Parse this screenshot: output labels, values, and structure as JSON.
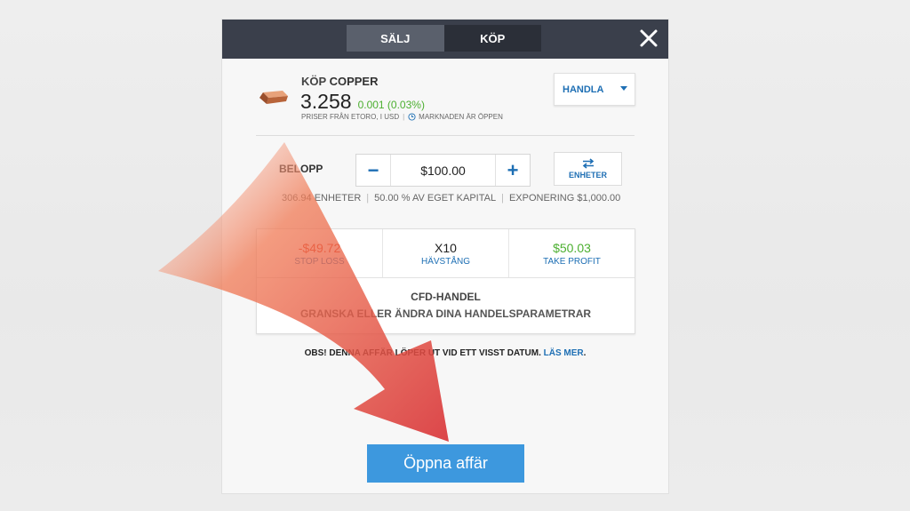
{
  "tabs": [
    {
      "label": "SÄLJ",
      "active": true
    },
    {
      "label": "KÖP",
      "active": false
    }
  ],
  "instrument": {
    "action": "KÖP",
    "name": "COPPER",
    "price": "3.258",
    "change": "0.001 (0.03%)",
    "price_source": "PRISER FRÅN ETORO, I USD",
    "market_status": "MARKNADEN ÄR ÖPPEN",
    "icon": "copper-ingot-icon"
  },
  "trade_dropdown": {
    "label": "HANDLA"
  },
  "amount": {
    "label": "BELOPP",
    "value": "$100.00",
    "units_button": "ENHETER"
  },
  "info": {
    "units": "306.94 ENHETER",
    "capital": "50.00 % AV EGET KAPITAL",
    "exposure": "EXPONERING $1,000.00"
  },
  "params": {
    "stop_loss": {
      "value": "-$49.72",
      "label": "STOP LOSS"
    },
    "leverage": {
      "value": "X10",
      "label": "HÄVSTÅNG"
    },
    "take_profit": {
      "value": "$50.03",
      "label": "TAKE PROFIT"
    }
  },
  "cfd": {
    "title": "CFD-HANDEL",
    "subtitle": "GRANSKA ELLER ÄNDRA DINA HANDELSPARAMETRAR"
  },
  "expiry_note": {
    "text": "OBS! DENNA AFFÄR LÖPER UT VID ETT VISST DATUM.",
    "link": "LÄS MER"
  },
  "open_button": "Öppna affär",
  "colors": {
    "header": "#3a3f4b",
    "accent": "#1e6fb4",
    "button": "#3d98de",
    "loss": "#e0331c",
    "profit": "#4caf30",
    "arrow": "#e03a2a"
  }
}
